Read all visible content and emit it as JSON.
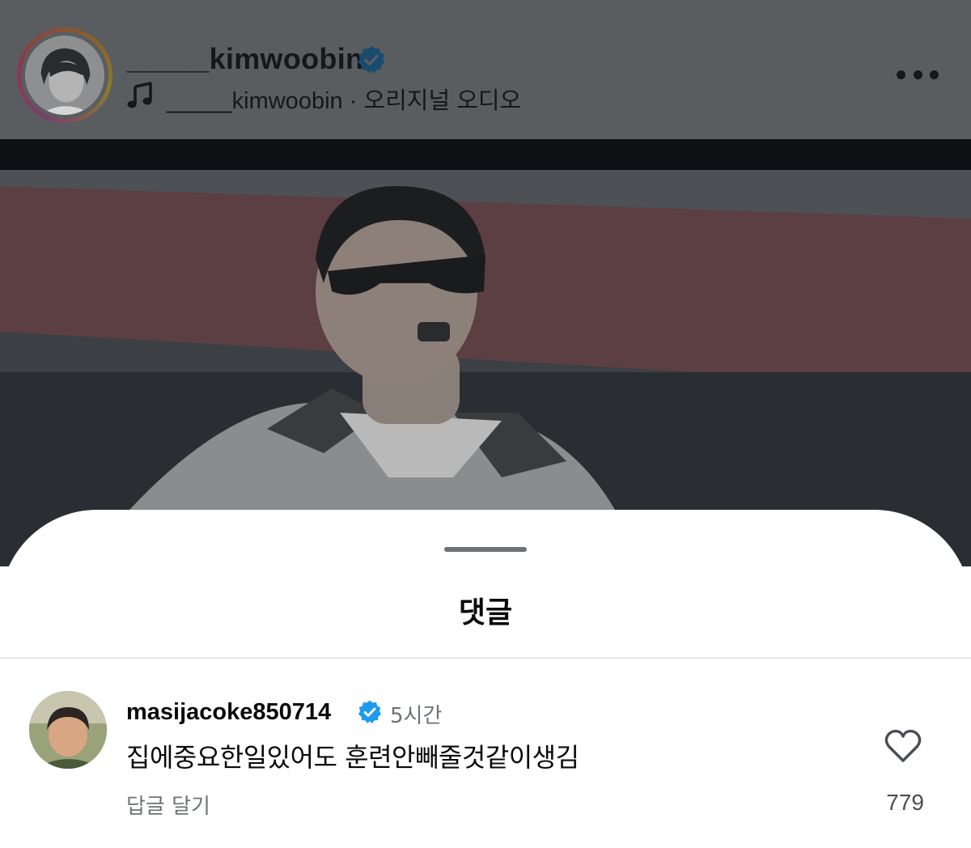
{
  "post": {
    "username": "_____kimwoobin",
    "audio": "_____kimwoobin · 오리지널 오디오"
  },
  "sheet": {
    "title": "댓글"
  },
  "comment": {
    "username": "masijacoke850714",
    "time": "5시간",
    "text": "집에중요한일있어도 훈련안빼줄것같이생김",
    "reply_label": "답글 달기",
    "like_count": "779"
  },
  "colors": {
    "verified": "#1d9bf0",
    "backdrop": "#585b5e",
    "secondary_text": "#6e7277"
  },
  "icons": [
    "verified-badge-icon",
    "music-note-icon",
    "more-options-icon",
    "heart-icon"
  ]
}
